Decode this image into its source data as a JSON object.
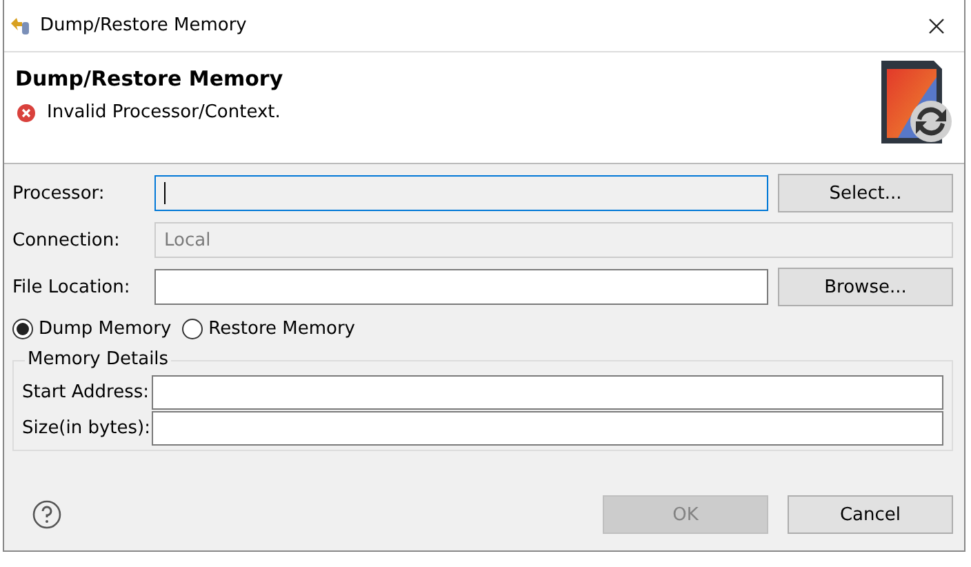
{
  "window": {
    "title": "Dump/Restore Memory"
  },
  "header": {
    "title": "Dump/Restore Memory",
    "message": {
      "kind": "error",
      "text": "Invalid Processor/Context."
    }
  },
  "fields": [
    {
      "label": "Processor:",
      "focused": true,
      "disabled": false,
      "button": "Select..."
    },
    {
      "label": "Connection:",
      "value": "Local",
      "focused": false,
      "disabled": true
    },
    {
      "label": "File Location:",
      "focused": false,
      "disabled": false,
      "button": "Browse..."
    }
  ],
  "modes": [
    {
      "label": "Dump Memory",
      "selected": true
    },
    {
      "label": "Restore Memory",
      "selected": false
    }
  ],
  "memory_details": {
    "title": "Memory Details",
    "fields": [
      {
        "label": "Start Address:"
      },
      {
        "label": "Size(in bytes):"
      }
    ]
  },
  "buttons": [
    {
      "label": "OK",
      "disabled": true
    },
    {
      "label": "Cancel",
      "disabled": false
    }
  ]
}
